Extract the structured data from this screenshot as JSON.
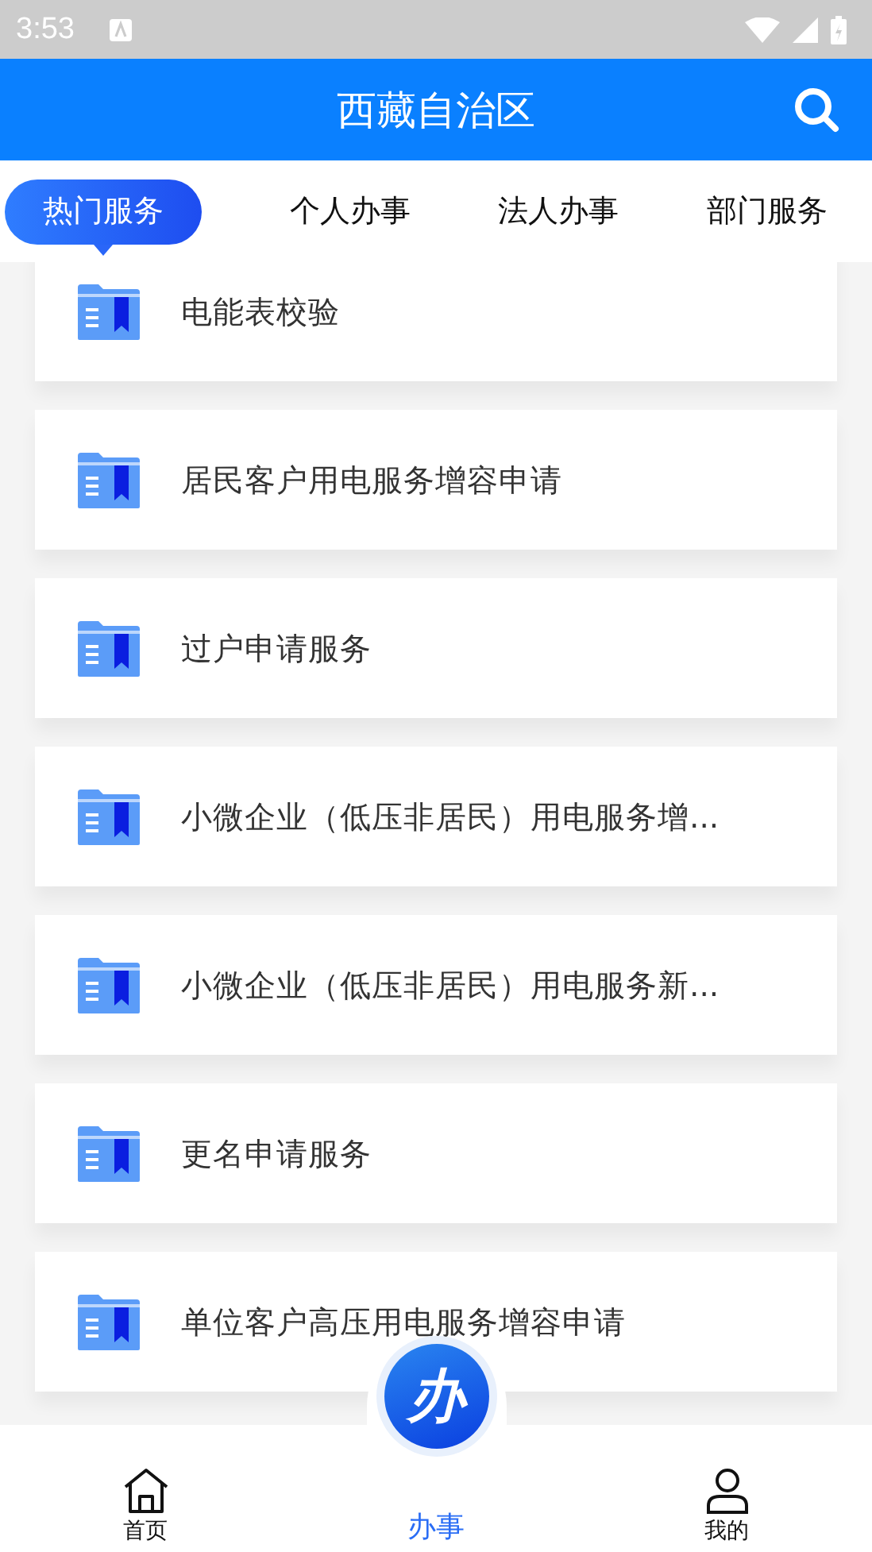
{
  "status_bar": {
    "time": "3:53"
  },
  "header": {
    "title": "西藏自治区"
  },
  "tabs": [
    {
      "label": "热门服务",
      "selected": true
    },
    {
      "label": "个人办事",
      "selected": false
    },
    {
      "label": "法人办事",
      "selected": false
    },
    {
      "label": "部门服务",
      "selected": false
    }
  ],
  "services": [
    {
      "label": "电能表校验"
    },
    {
      "label": "居民客户用电服务增容申请"
    },
    {
      "label": "过户申请服务"
    },
    {
      "label": "小微企业（低压非居民）用电服务增..."
    },
    {
      "label": "小微企业（低压非居民）用电服务新..."
    },
    {
      "label": "更名申请服务"
    },
    {
      "label": "单位客户高压用电服务增容申请"
    }
  ],
  "bottom_nav": [
    {
      "kind": "home",
      "label": "首页",
      "selected": false
    },
    {
      "kind": "center",
      "label": "办事",
      "badge": "办",
      "selected": true
    },
    {
      "kind": "profile",
      "label": "我的",
      "selected": false
    }
  ]
}
